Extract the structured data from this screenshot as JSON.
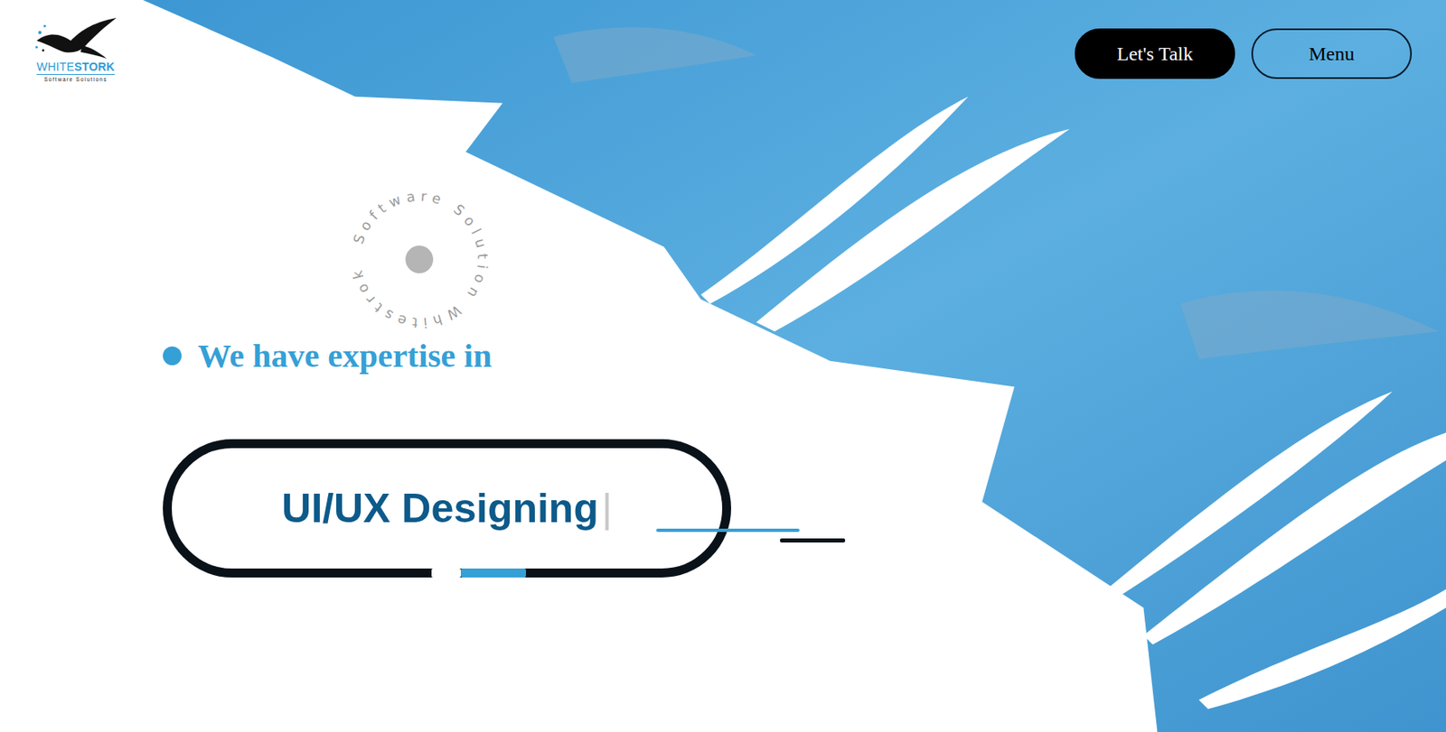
{
  "logo": {
    "brand_light": "WHITE",
    "brand_bold": "STORK",
    "tagline": "Software Solutions"
  },
  "nav": {
    "buttons": [
      {
        "label": "Let's Talk",
        "kind": "filled"
      },
      {
        "label": "Menu",
        "kind": "outline"
      }
    ]
  },
  "badge": {
    "circle_text": "Software Solution Whitestrok"
  },
  "hero": {
    "eyebrow": "We have expertise in",
    "typed": "UI/UX Designing",
    "cursor": "|"
  }
}
